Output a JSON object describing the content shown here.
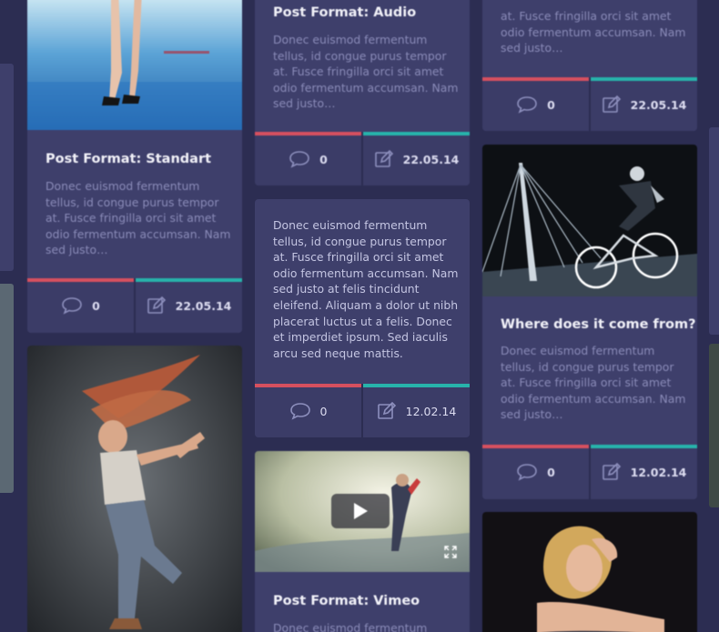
{
  "colors": {
    "background": "#2c2d52",
    "card": "#3e3f6b",
    "comments_bar": "#d6505f",
    "date_bar": "#27b3ab",
    "excerpt_text": "#8a8bb8",
    "title_text": "#f1f1f8"
  },
  "posts": {
    "standard": {
      "title": "Post Format: Standart",
      "excerpt": "Donec euismod fermentum tellus, id congue purus tempor at. Fusce fringilla orci sit amet odio fermentum accumsan. Nam sed justo…",
      "comments": "0",
      "date": "22.05.14",
      "image_icon": "legs-on-wet-street-photo"
    },
    "dancer": {
      "image_icon": "dancer-hair-flying-photo"
    },
    "audio": {
      "title": "Post Format: Audio",
      "excerpt": "Donec euismod fermentum tellus, id congue purus tempor at. Fusce fringilla orci sit amet odio fermentum accumsan. Nam sed justo…",
      "comments": "0",
      "date": "22.05.14"
    },
    "quote": {
      "excerpt": "Donec euismod fermentum tellus, id congue purus tempor at. Fusce fringilla orci sit amet odio fermentum accumsan. Nam sed justo at felis tincidunt eleifend. Aliquam a dolor ut nibh placerat luctus ut a felis. Donec et imperdiet ipsum. Sed iaculis arcu sed neque mattis.",
      "comments": "0",
      "date": "12.02.14"
    },
    "vimeo": {
      "title": "Post Format: Vimeo",
      "excerpt": "Donec euismod fermentum",
      "image_icon": "video-thumbnail-photo"
    },
    "top_right": {
      "excerpt": "at. Fusce fringilla orci sit amet odio fermentum accumsan. Nam sed justo…",
      "comments": "0",
      "date": "22.05.14"
    },
    "where": {
      "title": "Where does it come from?",
      "excerpt": "Donec euismod fermentum tellus, id congue purus tempor at. Fusce fringilla orci sit amet odio fermentum accumsan. Nam sed justo…",
      "comments": "0",
      "date": "12.02.14",
      "image_icon": "cyclist-at-night-bridge-photo"
    },
    "portrait": {
      "image_icon": "blonde-woman-portrait-photo"
    }
  },
  "icons": {
    "comment": "speech-bubble-icon",
    "date": "edit-square-icon",
    "play": "play-icon",
    "fullscreen": "fullscreen-icon"
  }
}
